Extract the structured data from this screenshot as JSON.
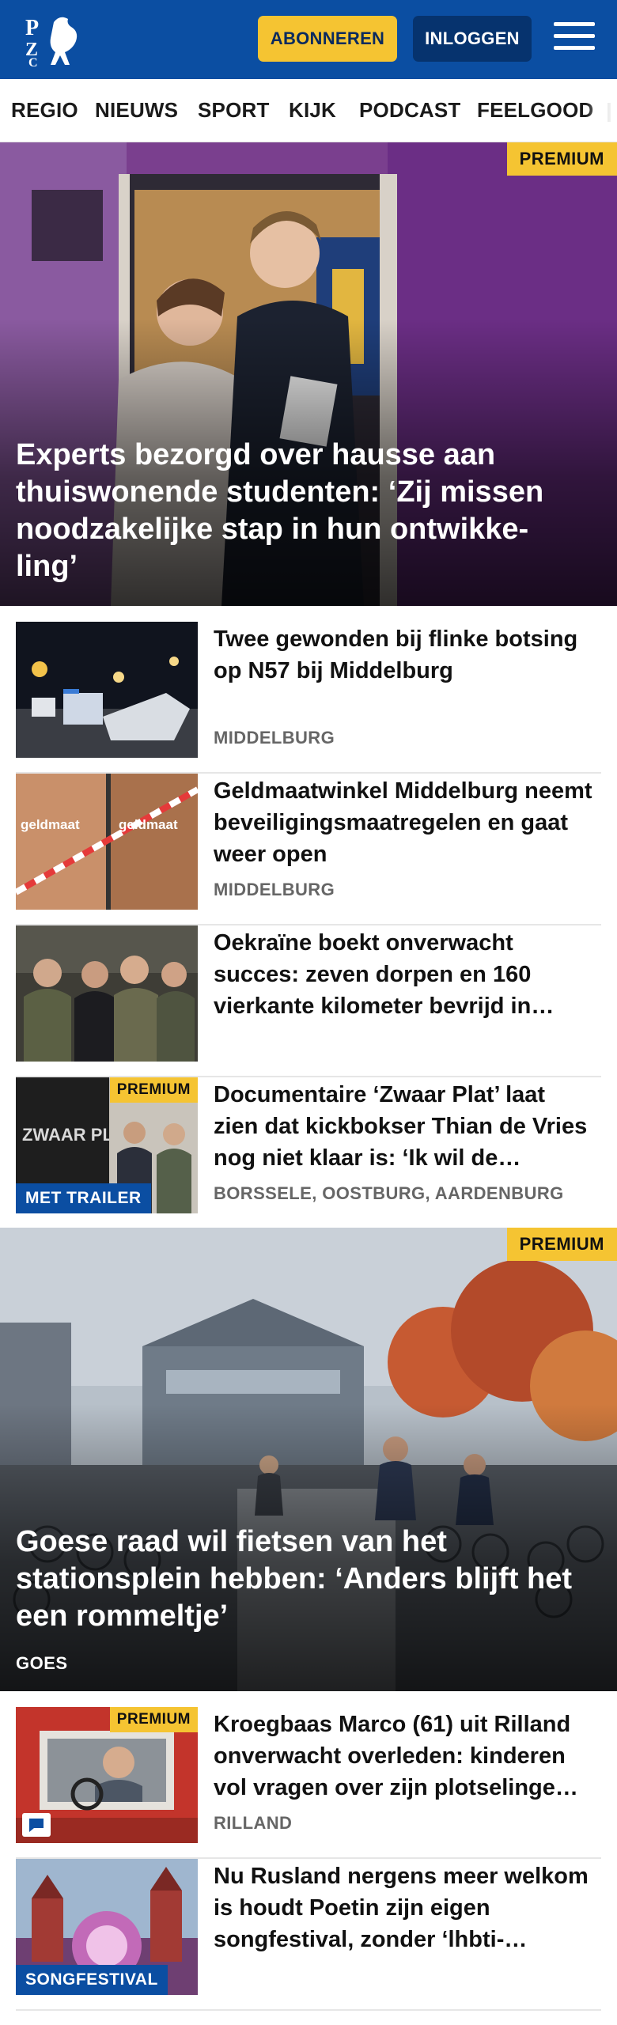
{
  "header": {
    "logo_letters": "PZC",
    "subscribe_label": "ABONNEREN",
    "login_label": "INLOGGEN",
    "brand_color": "#0b4ea2",
    "accent_color": "#f5c432",
    "menu_icon": "hamburger-menu-icon"
  },
  "nav": {
    "items": [
      {
        "label": "REGIO"
      },
      {
        "label": "NIEUWS"
      },
      {
        "label": "SPORT"
      },
      {
        "label": "KIJK"
      },
      {
        "label": "PODCAST"
      },
      {
        "label": "FEELGOOD"
      }
    ]
  },
  "hero1": {
    "premium_label": "PREMIUM",
    "title": "Experts bezorgd over hausse aan thuiswonende studenten: ‘Zij missen noodzakelijke stap in hun ontwikke-ling’"
  },
  "articles": [
    {
      "title": "Twee gewonden bij flinke botsing op N57 bij Middelburg",
      "location": "MIDDELBURG"
    },
    {
      "title": "Geldmaatwinkel Middelburg neemt beveiligingsmaatregelen en gaat weer open",
      "location": "MIDDELBURG",
      "thumb_text": "geldmaat"
    },
    {
      "title": "Oekraïne boekt onverwacht succes: zeven dorpen en 160 vierkante kilometer bevrijd in…",
      "location": ""
    },
    {
      "title": "Documentaire ‘Zwaar Plat’ laat zien dat kickbokser Thian de Vries nog niet klaar is: ‘Ik wil de…",
      "location": "BORSSELE, OOSTBURG, AARDENBURG",
      "premium_label": "PREMIUM",
      "tag_label": "MET TRAILER",
      "thumb_text": "ZWAAR PLAT"
    }
  ],
  "hero2": {
    "premium_label": "PREMIUM",
    "title": "Goese raad wil fietsen van het stationsplein hebben: ‘Anders blijft het een rommeltje’",
    "location": "GOES"
  },
  "articles2": [
    {
      "title": "Kroegbaas Marco (61) uit Rilland onverwacht overleden: kinderen vol vragen over zijn plotselinge…",
      "location": "RILLAND",
      "premium_label": "PREMIUM",
      "badge_icon": "comment-icon"
    },
    {
      "title": "Nu Rusland nergens meer welkom is houdt Poetin zijn eigen songfestival, zonder ‘lhbti-…",
      "location": "",
      "tag_label": "SONGFESTIVAL"
    }
  ]
}
